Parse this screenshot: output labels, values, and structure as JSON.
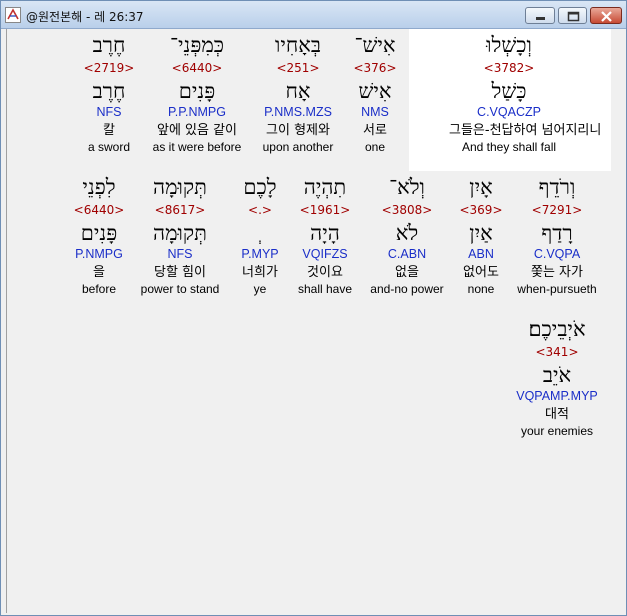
{
  "window": {
    "title": "@원전본해 - 레 26:37"
  },
  "rows": [
    [
      {
        "heb": "וְכָשְׁלוּ",
        "num": "<3782>",
        "lex": "כָּשַׁל",
        "morph": "C.VQACZP",
        "kor": "그들은-천답하여 넘어지리니",
        "eng": "And they shall fall"
      },
      {
        "heb": "אִישׁ־",
        "num": "<376>",
        "lex": "אִישׁ",
        "morph": "NMS",
        "kor": "서로",
        "eng": "one"
      },
      {
        "heb": "בְּאָחִיו",
        "num": "<251>",
        "lex": "אָח",
        "morph": "P.NMS.MZS",
        "kor": "그이 형제와",
        "eng": "upon another"
      },
      {
        "heb": "כְּמִפְּנֵי־",
        "num": "<6440>",
        "lex": "פָּנִים",
        "morph": "P.P.NMPG",
        "kor": "앞에 있음 같이",
        "eng": "as it were before"
      },
      {
        "heb": "חֶרֶב",
        "num": "<2719>",
        "lex": "חֶרֶב",
        "morph": "NFS",
        "kor": "칼",
        "eng": "a sword"
      }
    ],
    [
      {
        "heb": "וְרֹדֵף",
        "num": "<7291>",
        "lex": "רָדַף",
        "morph": "C.VQPA",
        "kor": "쫓는 자가",
        "eng": "when-pursueth"
      },
      {
        "heb": "אָיִן",
        "num": "<369>",
        "lex": "אַיִן",
        "morph": "ABN",
        "kor": "없어도",
        "eng": "none"
      },
      {
        "heb": "וְלֹא־",
        "num": "<3808>",
        "lex": "לֹא",
        "morph": "C.ABN",
        "kor": "없을",
        "eng": "and-no power"
      },
      {
        "heb": "תִהְיֶה",
        "num": "<1961>",
        "lex": "הָיָה",
        "morph": "VQIFZS",
        "kor": "것이요",
        "eng": "shall have"
      },
      {
        "heb": "לָכֶם",
        "num": "<.>",
        "lex": "ְ",
        "morph": "P.MYP",
        "kor": "너희가",
        "eng": "ye"
      },
      {
        "heb": "תְּקוּמָה",
        "num": "<8617>",
        "lex": "תְּקוּמָה",
        "morph": "NFS",
        "kor": "당할 힘이",
        "eng": "power  to stand"
      },
      {
        "heb": "לִפְנֵי",
        "num": "<6440>",
        "lex": "פָּנִים",
        "morph": "P.NMPG",
        "kor": "을",
        "eng": "before"
      }
    ],
    [
      {
        "heb": "אֹיְבֵיכֶם׃",
        "num": "<341>",
        "lex": "אֹיֵב",
        "morph": "VQPAMP.MYP",
        "kor": "대적",
        "eng": "your enemies"
      }
    ]
  ]
}
